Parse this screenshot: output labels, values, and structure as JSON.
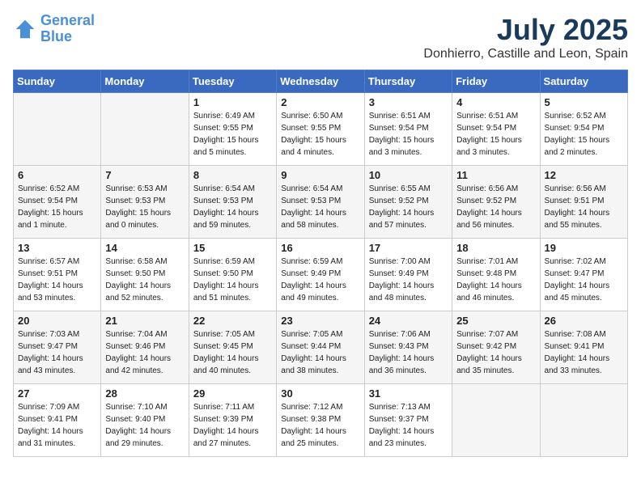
{
  "header": {
    "logo_line1": "General",
    "logo_line2": "Blue",
    "month": "July 2025",
    "location": "Donhierro, Castille and Leon, Spain"
  },
  "weekdays": [
    "Sunday",
    "Monday",
    "Tuesday",
    "Wednesday",
    "Thursday",
    "Friday",
    "Saturday"
  ],
  "weeks": [
    [
      {
        "day": "",
        "info": ""
      },
      {
        "day": "",
        "info": ""
      },
      {
        "day": "1",
        "info": "Sunrise: 6:49 AM\nSunset: 9:55 PM\nDaylight: 15 hours\nand 5 minutes."
      },
      {
        "day": "2",
        "info": "Sunrise: 6:50 AM\nSunset: 9:55 PM\nDaylight: 15 hours\nand 4 minutes."
      },
      {
        "day": "3",
        "info": "Sunrise: 6:51 AM\nSunset: 9:54 PM\nDaylight: 15 hours\nand 3 minutes."
      },
      {
        "day": "4",
        "info": "Sunrise: 6:51 AM\nSunset: 9:54 PM\nDaylight: 15 hours\nand 3 minutes."
      },
      {
        "day": "5",
        "info": "Sunrise: 6:52 AM\nSunset: 9:54 PM\nDaylight: 15 hours\nand 2 minutes."
      }
    ],
    [
      {
        "day": "6",
        "info": "Sunrise: 6:52 AM\nSunset: 9:54 PM\nDaylight: 15 hours\nand 1 minute."
      },
      {
        "day": "7",
        "info": "Sunrise: 6:53 AM\nSunset: 9:53 PM\nDaylight: 15 hours\nand 0 minutes."
      },
      {
        "day": "8",
        "info": "Sunrise: 6:54 AM\nSunset: 9:53 PM\nDaylight: 14 hours\nand 59 minutes."
      },
      {
        "day": "9",
        "info": "Sunrise: 6:54 AM\nSunset: 9:53 PM\nDaylight: 14 hours\nand 58 minutes."
      },
      {
        "day": "10",
        "info": "Sunrise: 6:55 AM\nSunset: 9:52 PM\nDaylight: 14 hours\nand 57 minutes."
      },
      {
        "day": "11",
        "info": "Sunrise: 6:56 AM\nSunset: 9:52 PM\nDaylight: 14 hours\nand 56 minutes."
      },
      {
        "day": "12",
        "info": "Sunrise: 6:56 AM\nSunset: 9:51 PM\nDaylight: 14 hours\nand 55 minutes."
      }
    ],
    [
      {
        "day": "13",
        "info": "Sunrise: 6:57 AM\nSunset: 9:51 PM\nDaylight: 14 hours\nand 53 minutes."
      },
      {
        "day": "14",
        "info": "Sunrise: 6:58 AM\nSunset: 9:50 PM\nDaylight: 14 hours\nand 52 minutes."
      },
      {
        "day": "15",
        "info": "Sunrise: 6:59 AM\nSunset: 9:50 PM\nDaylight: 14 hours\nand 51 minutes."
      },
      {
        "day": "16",
        "info": "Sunrise: 6:59 AM\nSunset: 9:49 PM\nDaylight: 14 hours\nand 49 minutes."
      },
      {
        "day": "17",
        "info": "Sunrise: 7:00 AM\nSunset: 9:49 PM\nDaylight: 14 hours\nand 48 minutes."
      },
      {
        "day": "18",
        "info": "Sunrise: 7:01 AM\nSunset: 9:48 PM\nDaylight: 14 hours\nand 46 minutes."
      },
      {
        "day": "19",
        "info": "Sunrise: 7:02 AM\nSunset: 9:47 PM\nDaylight: 14 hours\nand 45 minutes."
      }
    ],
    [
      {
        "day": "20",
        "info": "Sunrise: 7:03 AM\nSunset: 9:47 PM\nDaylight: 14 hours\nand 43 minutes."
      },
      {
        "day": "21",
        "info": "Sunrise: 7:04 AM\nSunset: 9:46 PM\nDaylight: 14 hours\nand 42 minutes."
      },
      {
        "day": "22",
        "info": "Sunrise: 7:05 AM\nSunset: 9:45 PM\nDaylight: 14 hours\nand 40 minutes."
      },
      {
        "day": "23",
        "info": "Sunrise: 7:05 AM\nSunset: 9:44 PM\nDaylight: 14 hours\nand 38 minutes."
      },
      {
        "day": "24",
        "info": "Sunrise: 7:06 AM\nSunset: 9:43 PM\nDaylight: 14 hours\nand 36 minutes."
      },
      {
        "day": "25",
        "info": "Sunrise: 7:07 AM\nSunset: 9:42 PM\nDaylight: 14 hours\nand 35 minutes."
      },
      {
        "day": "26",
        "info": "Sunrise: 7:08 AM\nSunset: 9:41 PM\nDaylight: 14 hours\nand 33 minutes."
      }
    ],
    [
      {
        "day": "27",
        "info": "Sunrise: 7:09 AM\nSunset: 9:41 PM\nDaylight: 14 hours\nand 31 minutes."
      },
      {
        "day": "28",
        "info": "Sunrise: 7:10 AM\nSunset: 9:40 PM\nDaylight: 14 hours\nand 29 minutes."
      },
      {
        "day": "29",
        "info": "Sunrise: 7:11 AM\nSunset: 9:39 PM\nDaylight: 14 hours\nand 27 minutes."
      },
      {
        "day": "30",
        "info": "Sunrise: 7:12 AM\nSunset: 9:38 PM\nDaylight: 14 hours\nand 25 minutes."
      },
      {
        "day": "31",
        "info": "Sunrise: 7:13 AM\nSunset: 9:37 PM\nDaylight: 14 hours\nand 23 minutes."
      },
      {
        "day": "",
        "info": ""
      },
      {
        "day": "",
        "info": ""
      }
    ]
  ]
}
